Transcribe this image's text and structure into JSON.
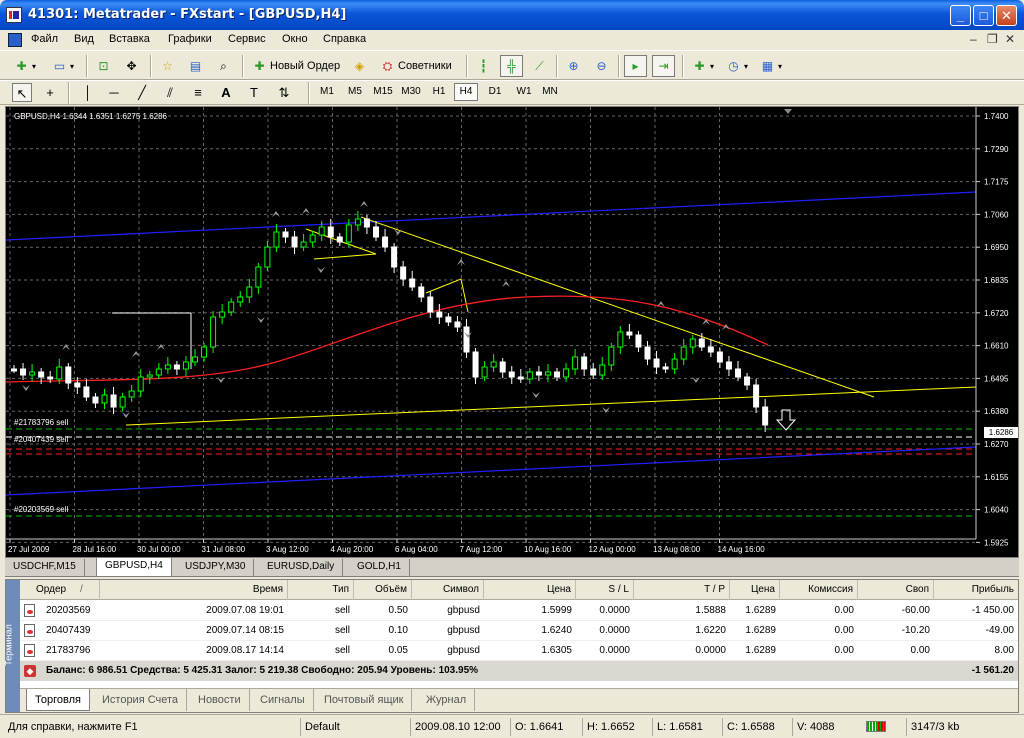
{
  "window": {
    "title": "41301: Metatrader - FXstart - [GBPUSD,H4]"
  },
  "menu": [
    "Файл",
    "Вид",
    "Вставка",
    "Графики",
    "Сервис",
    "Окно",
    "Справка"
  ],
  "toolbar": {
    "new_order": "Новый Ордер",
    "experts": "Советники"
  },
  "timeframes": [
    "M1",
    "M5",
    "M15",
    "M30",
    "H1",
    "H4",
    "D1",
    "W1",
    "MN"
  ],
  "active_timeframe": "H4",
  "chart": {
    "info": "GBPUSD,H4  1.6344 1.6351 1.6275 1.6286",
    "current_price": "1.6286",
    "y_ticks": [
      "1.7400",
      "1.7290",
      "1.7175",
      "1.7060",
      "1.6950",
      "1.6835",
      "1.6720",
      "1.6610",
      "1.6495",
      "1.6380",
      "1.6270",
      "1.6155",
      "1.6040",
      "1.5925"
    ],
    "x_ticks": [
      "27 Jul 2009",
      "28 Jul 16:00",
      "30 Jul 00:00",
      "31 Jul 08:00",
      "3 Aug 12:00",
      "4 Aug 20:00",
      "6 Aug 04:00",
      "7 Aug 12:00",
      "10 Aug 16:00",
      "12 Aug 00:00",
      "13 Aug 08:00",
      "14 Aug 16:00"
    ],
    "order_labels": [
      "#21783796 sell",
      "#20407439 sell",
      "#20203569 sell"
    ],
    "colors": {
      "bull": "#00ff00",
      "bear": "#ffffff",
      "ma": "#ff2020",
      "channel": "#2020ff",
      "trend": "#ffff00"
    }
  },
  "chart_tabs": [
    "USDCHF,M15",
    "GBPUSD,H4",
    "USDJPY,M30",
    "EURUSD,Daily",
    "GOLD,H1"
  ],
  "active_chart_tab": "GBPUSD,H4",
  "terminal": {
    "side_label": "Терминал",
    "columns": [
      "Ордер",
      "/",
      "Время",
      "Тип",
      "Объём",
      "Символ",
      "Цена",
      "S / L",
      "T / P",
      "Цена",
      "Комиссия",
      "Своп",
      "Прибыль"
    ],
    "rows": [
      {
        "order": "20203569",
        "time": "2009.07.08 19:01",
        "type": "sell",
        "volume": "0.50",
        "symbol": "gbpusd",
        "price": "1.5999",
        "sl": "0.0000",
        "tp": "1.5888",
        "cur_price": "1.6289",
        "commission": "0.00",
        "swap": "-60.00",
        "profit": "-1 450.00"
      },
      {
        "order": "20407439",
        "time": "2009.07.14 08:15",
        "type": "sell",
        "volume": "0.10",
        "symbol": "gbpusd",
        "price": "1.6240",
        "sl": "0.0000",
        "tp": "1.6220",
        "cur_price": "1.6289",
        "commission": "0.00",
        "swap": "-10.20",
        "profit": "-49.00"
      },
      {
        "order": "21783796",
        "time": "2009.08.17 14:14",
        "type": "sell",
        "volume": "0.05",
        "symbol": "gbpusd",
        "price": "1.6305",
        "sl": "0.0000",
        "tp": "0.0000",
        "cur_price": "1.6289",
        "commission": "0.00",
        "swap": "0.00",
        "profit": "8.00"
      }
    ],
    "balance_line": "Баланс: 6 986.51  Средства: 5 425.31  Залог: 5 219.38  Свободно: 205.94  Уровень: 103.95%",
    "total_profit": "-1 561.20",
    "tabs": [
      "Торговля",
      "История Счета",
      "Новости",
      "Сигналы",
      "Почтовый ящик",
      "Журнал"
    ],
    "active_tab": "Торговля"
  },
  "status": {
    "help": "Для справки, нажмите F1",
    "profile": "Default",
    "datetime": "2009.08.10 12:00",
    "open": "O: 1.6641",
    "high": "H: 1.6652",
    "low": "L: 1.6581",
    "close": "C: 1.6588",
    "volume": "V: 4088",
    "traffic": "3147/3 kb"
  }
}
